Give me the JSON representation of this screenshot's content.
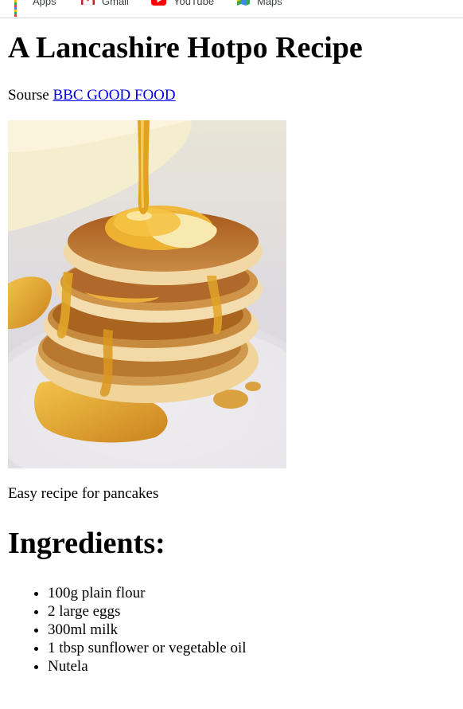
{
  "bookmarks": [
    {
      "label": "Apps",
      "icon": "apps-grid-icon"
    },
    {
      "label": "Gmail",
      "icon": "gmail-icon"
    },
    {
      "label": "YouTube",
      "icon": "youtube-icon"
    },
    {
      "label": "Maps",
      "icon": "maps-icon"
    }
  ],
  "page": {
    "title": "A Lancashire Hotpo Recipe",
    "source_prefix": "Sourse",
    "source_link": "BBC GOOD FOOD",
    "image_alt": "pancake-stack-photo",
    "caption": "Easy recipe for pancakes",
    "ingredients_heading": "Ingredients:",
    "ingredients": [
      "100g plain flour",
      "2 large eggs",
      "300ml milk",
      "1 tbsp sunflower or vegetable oil",
      "Nutela"
    ]
  },
  "colors": {
    "link": "#0000ee",
    "syrup": "#e3a21c",
    "pancake": "#c9853a",
    "plate": "#e9e6e8"
  }
}
